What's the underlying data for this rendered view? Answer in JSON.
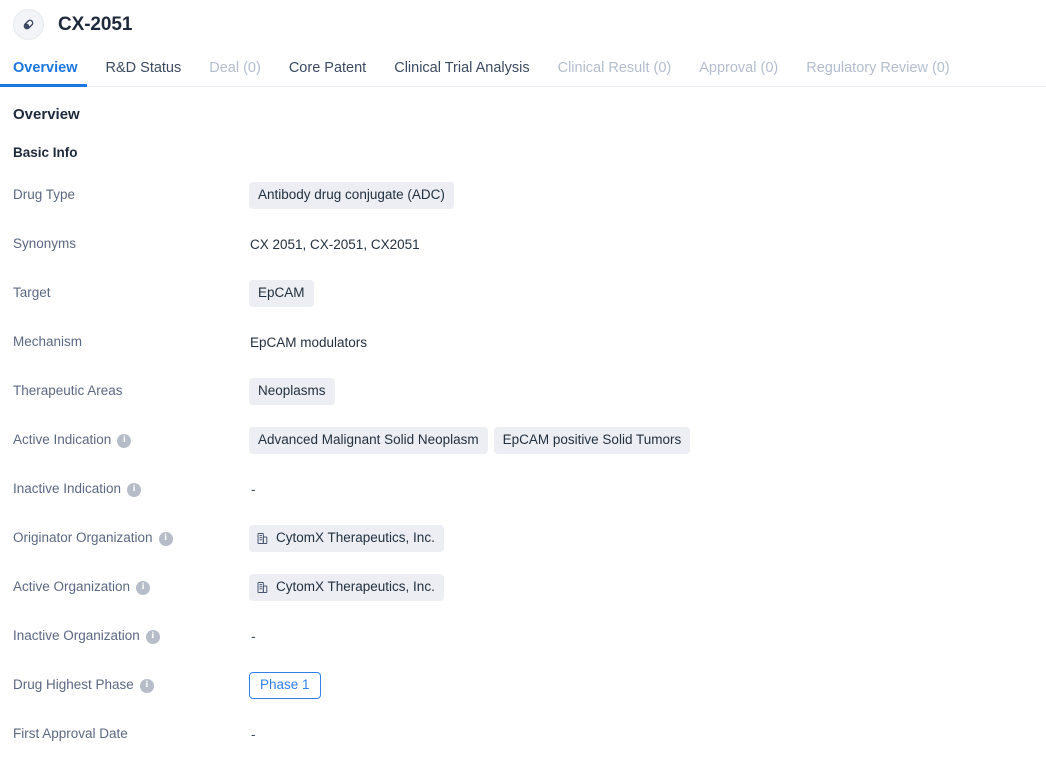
{
  "header": {
    "icon": "pill-capsule-icon",
    "title": "CX-2051"
  },
  "tabs": [
    {
      "label": "Overview",
      "state": "active"
    },
    {
      "label": "R&D Status",
      "state": "enabled"
    },
    {
      "label": "Deal (0)",
      "state": "disabled"
    },
    {
      "label": "Core Patent",
      "state": "enabled"
    },
    {
      "label": "Clinical Trial Analysis",
      "state": "enabled"
    },
    {
      "label": "Clinical Result (0)",
      "state": "disabled"
    },
    {
      "label": "Approval (0)",
      "state": "disabled"
    },
    {
      "label": "Regulatory Review (0)",
      "state": "disabled"
    }
  ],
  "main": {
    "section_title": "Overview",
    "subsection_title": "Basic Info",
    "rows": [
      {
        "label": "Drug Type",
        "has_info": false,
        "type": "chips",
        "chips": [
          "Antibody drug conjugate (ADC)"
        ]
      },
      {
        "label": "Synonyms",
        "has_info": false,
        "type": "text",
        "text": "CX 2051,  CX-2051,  CX2051"
      },
      {
        "label": "Target",
        "has_info": false,
        "type": "chips",
        "chips": [
          "EpCAM"
        ]
      },
      {
        "label": "Mechanism",
        "has_info": false,
        "type": "text",
        "text": "EpCAM modulators"
      },
      {
        "label": "Therapeutic Areas",
        "has_info": false,
        "type": "chips",
        "chips": [
          "Neoplasms"
        ]
      },
      {
        "label": "Active Indication",
        "has_info": true,
        "type": "chips",
        "chips": [
          "Advanced Malignant Solid Neoplasm",
          "EpCAM positive Solid Tumors"
        ]
      },
      {
        "label": "Inactive Indication",
        "has_info": true,
        "type": "dash",
        "text": "-"
      },
      {
        "label": "Originator Organization",
        "has_info": true,
        "type": "org-chips",
        "chips": [
          "CytomX Therapeutics, Inc."
        ]
      },
      {
        "label": "Active Organization",
        "has_info": true,
        "type": "org-chips",
        "chips": [
          "CytomX Therapeutics, Inc."
        ]
      },
      {
        "label": "Inactive Organization",
        "has_info": true,
        "type": "dash",
        "text": "-"
      },
      {
        "label": "Drug Highest Phase",
        "has_info": true,
        "type": "badge",
        "badge": "Phase 1"
      },
      {
        "label": "First Approval Date",
        "has_info": false,
        "type": "dash",
        "text": "-"
      }
    ],
    "info_icon_glyph": "i",
    "org_icon": "organization-building-icon"
  },
  "colors": {
    "accent": "#1b76e0",
    "badge_blue": "#2f80ed",
    "chip_bg": "#eceef3",
    "label_text": "#5b6882",
    "disabled_tab": "#b4bdcd"
  }
}
